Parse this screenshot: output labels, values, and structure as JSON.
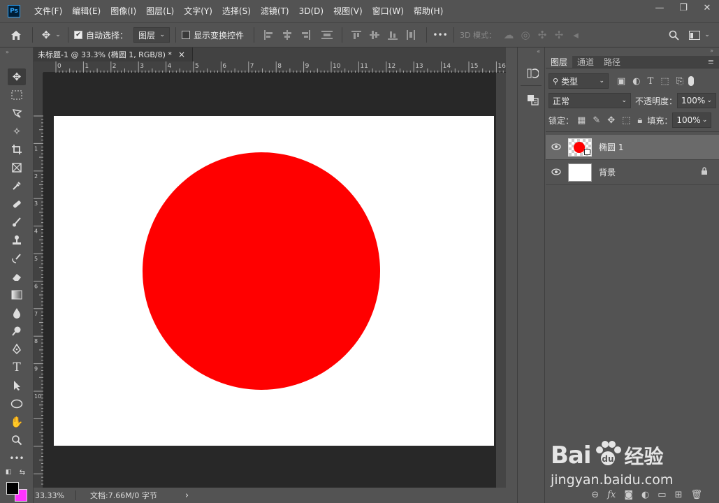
{
  "app": {
    "logo": "Ps"
  },
  "menu": [
    "文件(F)",
    "编辑(E)",
    "图像(I)",
    "图层(L)",
    "文字(Y)",
    "选择(S)",
    "滤镜(T)",
    "3D(D)",
    "视图(V)",
    "窗口(W)",
    "帮助(H)"
  ],
  "window_controls": {
    "minimize": "—",
    "restore": "❐",
    "close": "✕"
  },
  "options": {
    "auto_select_label": "自动选择：",
    "auto_select_checked": true,
    "auto_select_target": "图层",
    "show_transform_label": "显示变换控件",
    "mode_3d_label": "3D 模式：",
    "more": "•••"
  },
  "document": {
    "tab_title": "未标题-1 @ 33.3% (椭圆 1, RGB/8) *",
    "close": "×",
    "ruler_top_ticks": [
      "0",
      "1",
      "2",
      "3",
      "4",
      "5",
      "6",
      "7",
      "8",
      "9",
      "10",
      "11",
      "12",
      "13",
      "14",
      "15",
      "16"
    ],
    "ruler_left_ticks": [
      "1",
      "2",
      "3",
      "4",
      "5",
      "6",
      "7",
      "8",
      "9",
      "10"
    ],
    "canvas_bg": "#ffffff",
    "shape_color": "#ff0000"
  },
  "status": {
    "zoom": "33.33%",
    "doc_info": "文档:7.66M/0 字节",
    "arrow": "›"
  },
  "layers_panel": {
    "tabs": [
      "图层",
      "通道",
      "路径"
    ],
    "filter_label": "类型",
    "blend_mode": "正常",
    "opacity_label": "不透明度：",
    "opacity_value": "100%",
    "lock_label": "锁定：",
    "fill_label": "填充：",
    "fill_value": "100%",
    "layers": [
      {
        "name": "椭圆 1",
        "selected": true
      },
      {
        "name": "背景",
        "selected": false,
        "locked": true
      }
    ],
    "bottom_icons": [
      "link-icon",
      "fx-icon",
      "mask-icon",
      "adjustment-icon",
      "folder-icon",
      "new-layer-icon",
      "trash-icon"
    ]
  },
  "watermark": {
    "brand": "Bai",
    "brand_cn": "经验",
    "url": "jingyan.baidu.com"
  },
  "colors": {
    "foreground": "#000000",
    "background": "#ff33ff",
    "accent": "#31a8ff"
  }
}
